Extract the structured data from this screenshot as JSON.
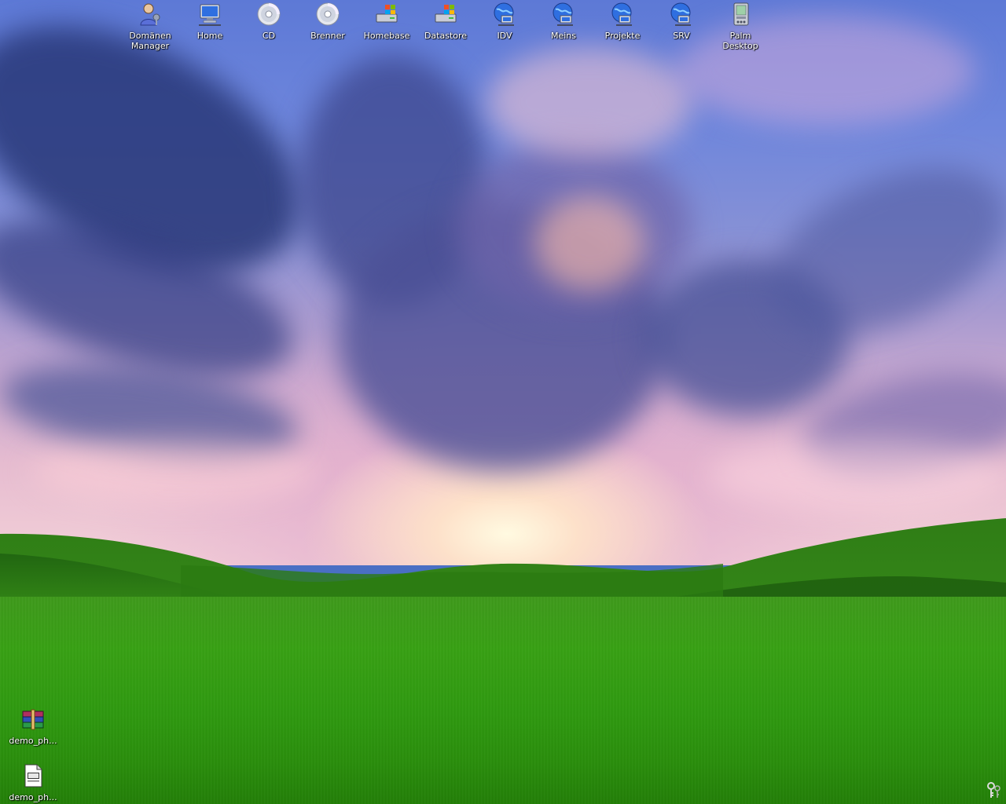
{
  "desktop": {
    "top_icons": [
      {
        "name": "domaenen-manager",
        "label": "Domänen\nManager",
        "icon": "user-admin-icon"
      },
      {
        "name": "home",
        "label": "Home",
        "icon": "network-drive-icon"
      },
      {
        "name": "cd",
        "label": "CD",
        "icon": "cd-icon"
      },
      {
        "name": "brenner",
        "label": "Brenner",
        "icon": "cd-icon"
      },
      {
        "name": "homebase",
        "label": "Homebase",
        "icon": "drive-icon"
      },
      {
        "name": "datastore",
        "label": "Datastore",
        "icon": "drive-icon"
      },
      {
        "name": "idv",
        "label": "IDV",
        "icon": "network-globe-icon"
      },
      {
        "name": "meins",
        "label": "Meins",
        "icon": "network-globe-icon"
      },
      {
        "name": "projekte",
        "label": "Projekte",
        "icon": "network-globe-icon"
      },
      {
        "name": "srv",
        "label": "SRV",
        "icon": "network-globe-icon"
      },
      {
        "name": "palm-desktop",
        "label": "Palm\nDesktop",
        "icon": "palm-icon"
      }
    ],
    "bottom_icons": [
      {
        "name": "demo-archive",
        "label": "demo_ph...",
        "icon": "winrar-archive-icon"
      },
      {
        "name": "demo-file",
        "label": "demo_ph...",
        "icon": "document-icon"
      }
    ],
    "tray": {
      "icon": "keys-icon"
    }
  },
  "colors": {
    "sky_top": "#5d79d6",
    "sky_horizon": "#f3d0d8",
    "grass": "#38a114",
    "label_text": "#ffffff"
  }
}
